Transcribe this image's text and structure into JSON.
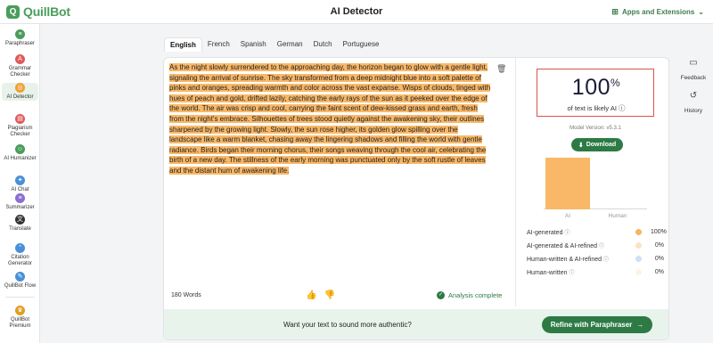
{
  "header": {
    "logo_text": "QuillBot",
    "title": "AI Detector",
    "apps_label": "Apps and Extensions"
  },
  "sidebar": {
    "items": [
      {
        "label": "Paraphraser",
        "icon": "paraphraser-icon",
        "color": "#4a9d5b",
        "glyph": "≡"
      },
      {
        "label": "Grammar Checker",
        "icon": "grammar-icon",
        "color": "#e05a5a",
        "glyph": "A"
      },
      {
        "label": "AI Detector",
        "icon": "ai-detector-icon",
        "color": "#f0a030",
        "glyph": "◎"
      },
      {
        "label": "Plagiarism Checker",
        "icon": "plagiarism-icon",
        "color": "#e05a5a",
        "glyph": "▤"
      },
      {
        "label": "AI Humanizer",
        "icon": "humanizer-icon",
        "color": "#4a9d5b",
        "glyph": "☺"
      },
      {
        "label": "AI Chat",
        "icon": "ai-chat-icon",
        "color": "#4a90d9",
        "glyph": "✦"
      },
      {
        "label": "Summarizer",
        "icon": "summarizer-icon",
        "color": "#8a6fd1",
        "glyph": "≡"
      },
      {
        "label": "Translate",
        "icon": "translate-icon",
        "color": "#333333",
        "glyph": "文"
      },
      {
        "label": "Citation Generator",
        "icon": "citation-icon",
        "color": "#4a90d9",
        "glyph": "”"
      },
      {
        "label": "QuillBot Flow",
        "icon": "flow-icon",
        "color": "#4a90d9",
        "glyph": "✎"
      },
      {
        "label": "QuillBot Premium",
        "icon": "premium-icon",
        "color": "#e0a020",
        "glyph": "♛"
      }
    ]
  },
  "tabs": [
    "English",
    "French",
    "Spanish",
    "German",
    "Dutch",
    "Portuguese"
  ],
  "editor": {
    "text": "As the night slowly surrendered to the approaching day, the horizon began to glow with a gentle light, signaling the arrival of sunrise. The sky transformed from a deep midnight blue into a soft palette of pinks and oranges, spreading warmth and color across the vast expanse. Wisps of clouds, tinged with hues of peach and gold, drifted lazily, catching the early rays of the sun as it peeked over the edge of the world. The air was crisp and cool, carrying the faint scent of dew-kissed grass and earth, fresh from the night's embrace. Silhouettes of trees stood quietly against the awakening sky, their outlines sharpened by the growing light. Slowly, the sun rose higher, its golden glow spilling over the landscape like a warm blanket, chasing away the lingering shadows and filling the world with gentle radiance. Birds began their morning chorus, their songs weaving through the cool air, celebrating the birth of a new day. The stillness of the early morning was punctuated only by the soft rustle of leaves and the distant hum of awakening life.",
    "word_count": "180 Words",
    "status": "Analysis complete"
  },
  "result": {
    "score": "100",
    "score_unit": "%",
    "caption": "of text is likely AI",
    "model_version": "Model Version: v5.3.1",
    "download_label": "Download"
  },
  "chart_data": {
    "type": "bar",
    "categories": [
      "AI",
      "Human"
    ],
    "values": [
      100,
      0
    ],
    "ylim": [
      0,
      100
    ],
    "colors": [
      "#f9b867",
      "#f9b867"
    ]
  },
  "stats": [
    {
      "label": "AI-generated",
      "value": "100%",
      "color": "#f6b55f"
    },
    {
      "label": "AI-generated & AI-refined",
      "value": "0%",
      "color": "#fbe3c3"
    },
    {
      "label": "Human-written & AI-refined",
      "value": "0%",
      "color": "#cfe0f7"
    },
    {
      "label": "Human-written",
      "value": "0%",
      "color": "#fdf3e6"
    }
  ],
  "cta": {
    "question": "Want your text to sound more authentic?",
    "button_label": "Refine with Paraphraser"
  },
  "rail": {
    "feedback_label": "Feedback",
    "history_label": "History"
  }
}
